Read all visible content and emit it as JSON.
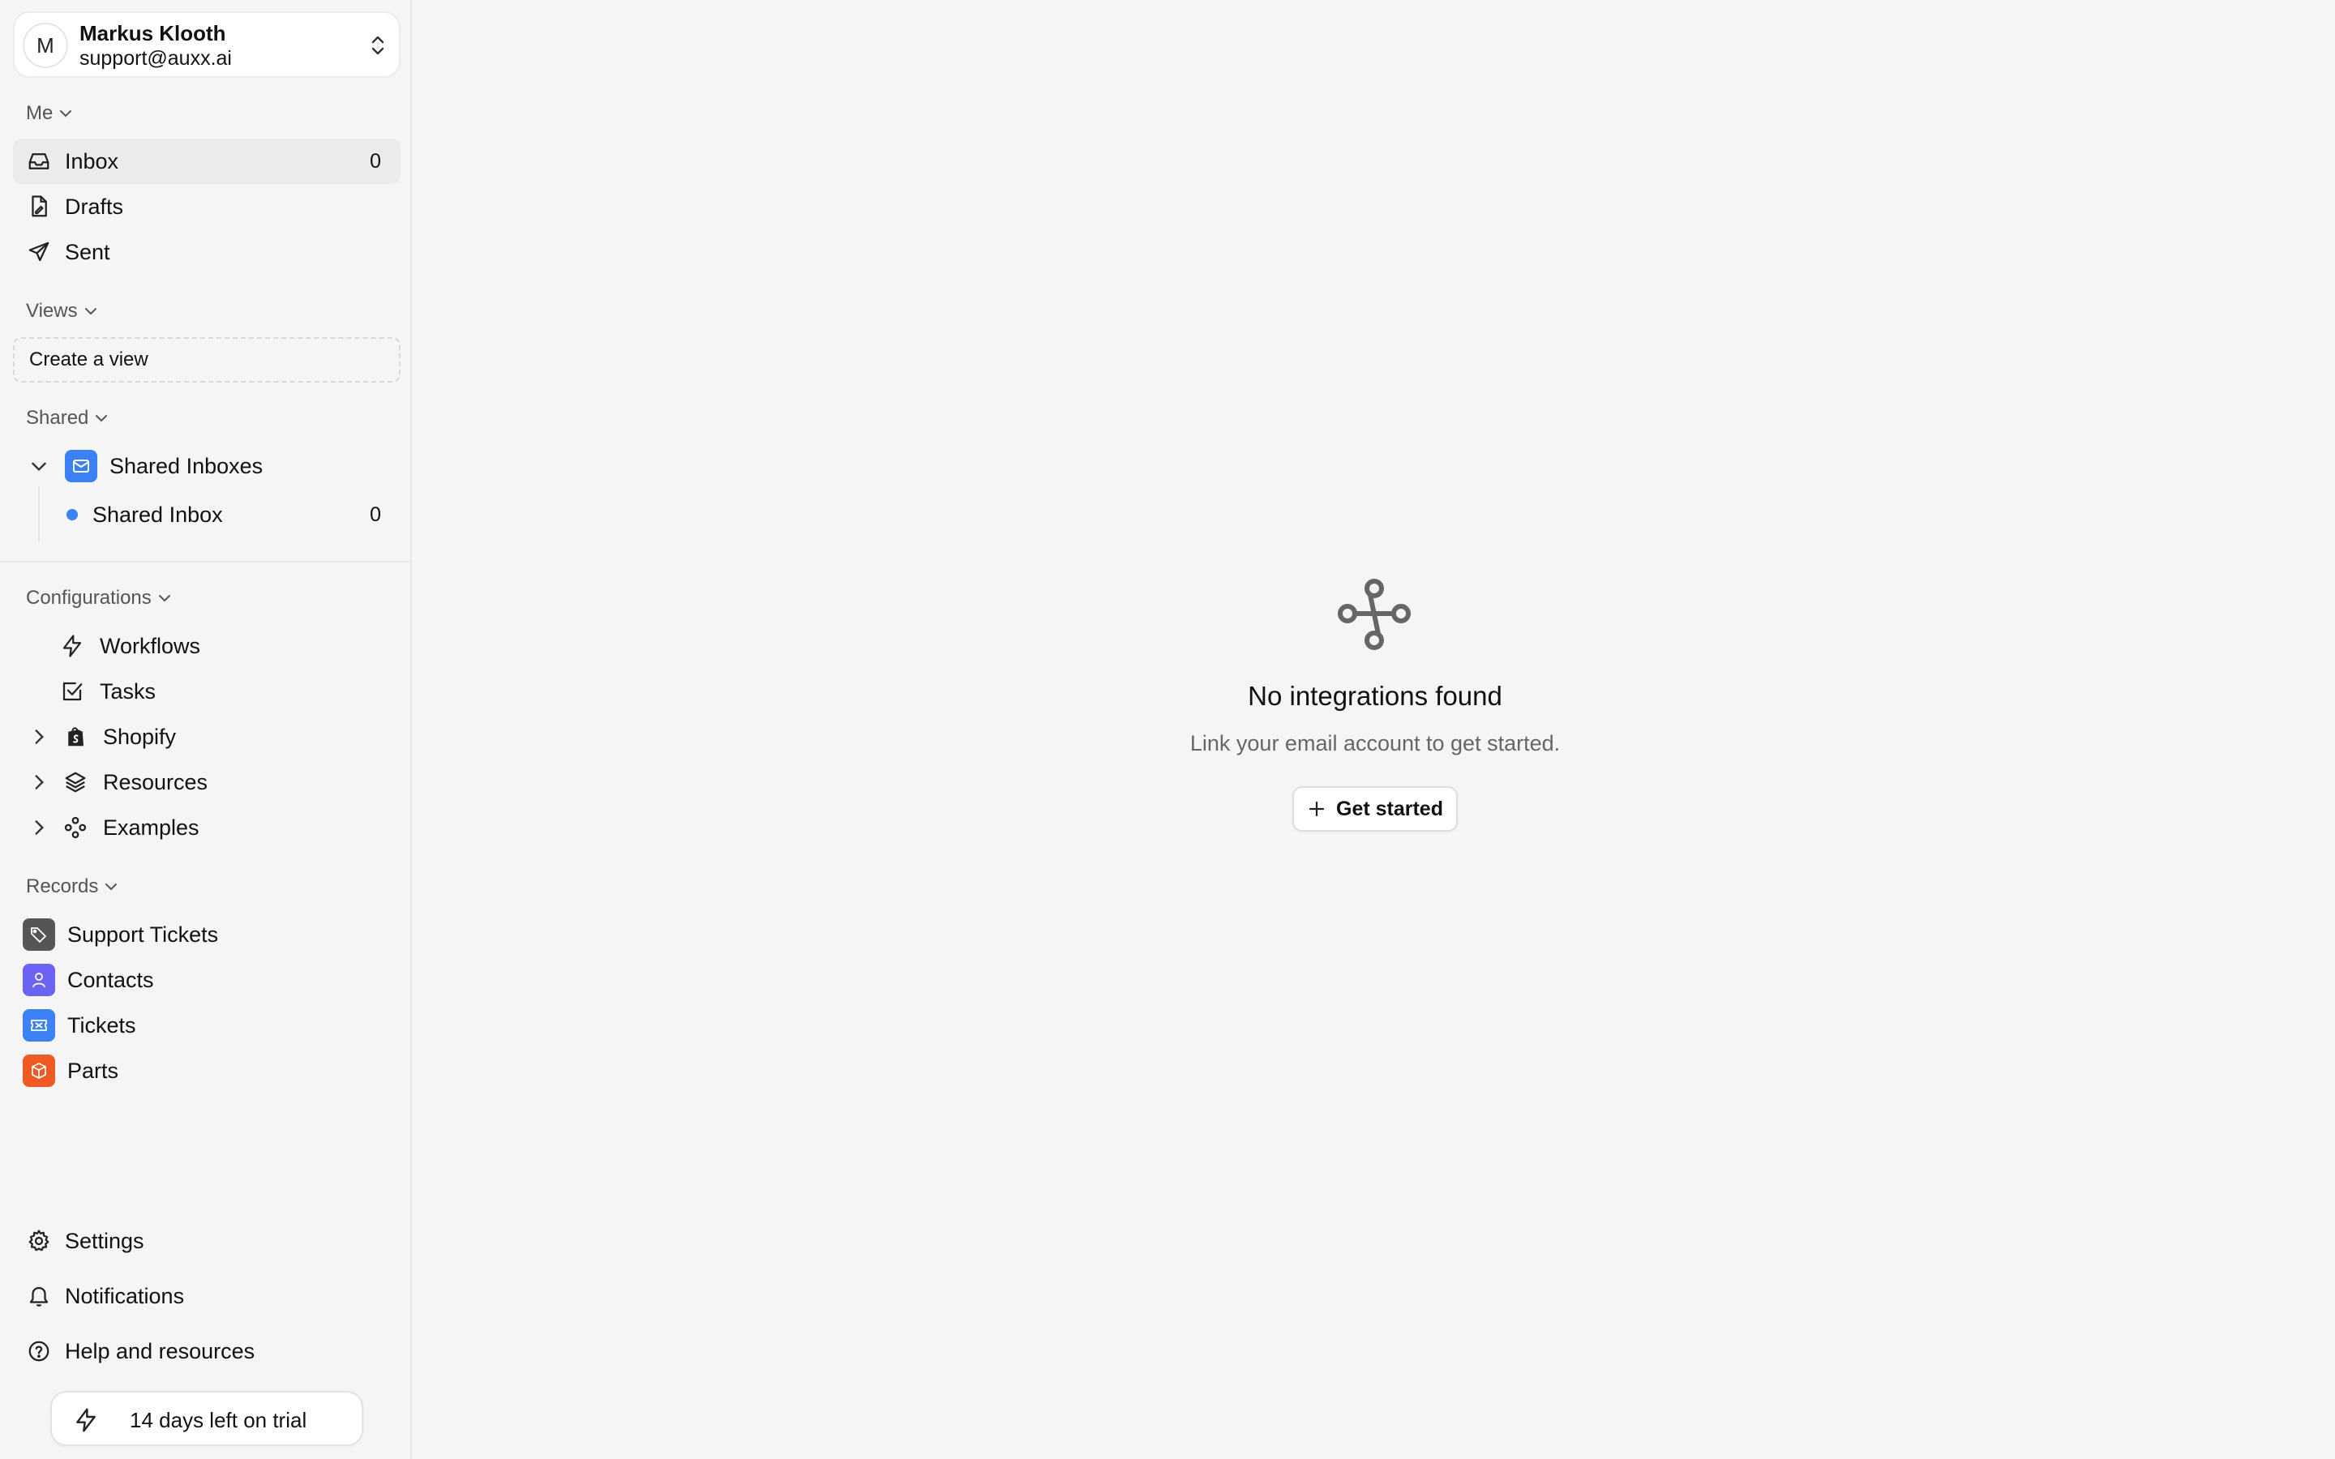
{
  "account": {
    "initial": "M",
    "name": "Markus Klooth",
    "email": "support@auxx.ai"
  },
  "sections": {
    "me": "Me",
    "views": "Views",
    "shared": "Shared",
    "configurations": "Configurations",
    "records": "Records"
  },
  "me_items": [
    {
      "label": "Inbox",
      "count": "0",
      "icon": "inbox-icon"
    },
    {
      "label": "Drafts",
      "icon": "drafts-icon"
    },
    {
      "label": "Sent",
      "icon": "send-icon"
    }
  ],
  "views": {
    "create_label": "Create a view"
  },
  "shared": {
    "group_label": "Shared Inboxes",
    "inbox_label": "Shared Inbox",
    "inbox_count": "0",
    "dot_color": "#3b82f6"
  },
  "configurations": [
    {
      "label": "Workflows",
      "icon": "bolt-icon"
    },
    {
      "label": "Tasks",
      "icon": "checkbox-icon"
    },
    {
      "label": "Shopify",
      "icon": "shopify-icon"
    },
    {
      "label": "Resources",
      "icon": "layers-icon"
    },
    {
      "label": "Examples",
      "icon": "components-icon"
    }
  ],
  "records": [
    {
      "label": "Support Tickets",
      "color": "#555555",
      "icon": "tag-icon"
    },
    {
      "label": "Contacts",
      "color": "#6c63f5",
      "icon": "user-icon"
    },
    {
      "label": "Tickets",
      "color": "#3b82f6",
      "icon": "ticket-icon"
    },
    {
      "label": "Parts",
      "color": "#f05a22",
      "icon": "box-icon"
    }
  ],
  "footer": {
    "settings": "Settings",
    "notifications": "Notifications",
    "help": "Help and resources",
    "trial": "14 days left on trial"
  },
  "empty_state": {
    "title": "No integrations found",
    "subtitle": "Link your email account to get started.",
    "button": "Get started"
  }
}
